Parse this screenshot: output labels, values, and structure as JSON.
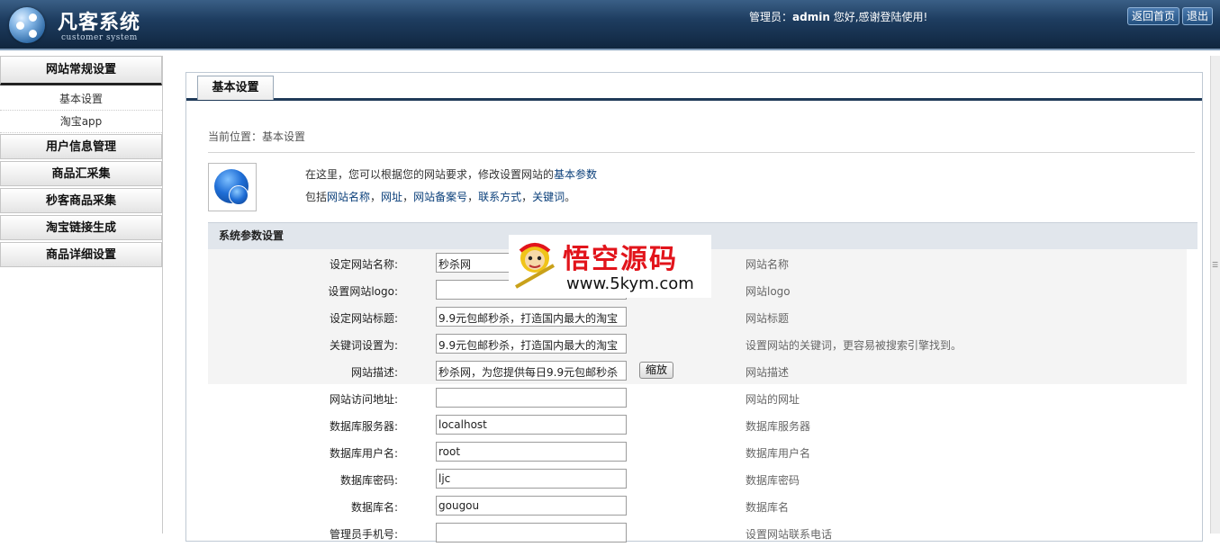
{
  "header": {
    "title": "凡客系统",
    "subtitle": "customer system",
    "welcome_prefix": "管理员：",
    "user": "admin",
    "welcome_suffix": " 您好,感谢登陆使用!",
    "btn_home": "返回首页",
    "btn_logout": "退出"
  },
  "sidebar": {
    "sections": [
      "网站常规设置",
      "用户信息管理",
      "商品汇采集",
      "秒客商品采集",
      "淘宝链接生成",
      "商品详细设置"
    ],
    "subitems": [
      "基本设置",
      "淘宝app"
    ]
  },
  "main": {
    "tab": "基本设置",
    "breadcrumb": "当前位置：基本设置",
    "intro": {
      "line1_text": "在这里，您可以根据您的网站要求，修改设置网站的",
      "line1_link": "基本参数",
      "line2_prefix": "包括",
      "link_name": "网站名称",
      "link_url": "网址",
      "link_icp": "网站备案号",
      "link_contact": "联系方式",
      "link_keywords": "关键词",
      "sep": "，",
      "end": "。"
    },
    "section_title": "系统参数设置",
    "rows": [
      {
        "label": "设定网站名称:",
        "value": "秒杀网",
        "hint": "网站名称"
      },
      {
        "label": "设置网站logo:",
        "value": "",
        "hint": "网站logo"
      },
      {
        "label": "设定网站标题:",
        "value": "9.9元包邮秒杀，打造国内最大的淘宝",
        "hint": "网站标题"
      },
      {
        "label": "关键词设置为:",
        "value": "9.9元包邮秒杀，打造国内最大的淘宝",
        "hint": "设置网站的关键词，更容易被搜索引擎找到。"
      },
      {
        "label": "网站描述:",
        "value": "秒杀网，为您提供每日9.9元包邮秒杀",
        "hint": "网站描述",
        "button": "缩放"
      },
      {
        "label": "网站访问地址:",
        "value": "",
        "hint": "网站的网址"
      },
      {
        "label": "数据库服务器:",
        "value": "localhost",
        "hint": "数据库服务器"
      },
      {
        "label": "数据库用户名:",
        "value": "root",
        "hint": "数据库用户名"
      },
      {
        "label": "数据库密码:",
        "value": "ljc",
        "hint": "数据库密码"
      },
      {
        "label": "数据库名:",
        "value": "gougou",
        "hint": "数据库名"
      },
      {
        "label": "管理员手机号:",
        "value": "",
        "hint": "设置网站联系电话"
      }
    ]
  },
  "watermark": {
    "title": "悟空源码",
    "url": "www.5kym.com"
  },
  "colors": {
    "header_top": "#3a5f86",
    "header_bottom": "#10263f",
    "link": "#0a3f7a",
    "watermark_red": "#e2141b"
  }
}
